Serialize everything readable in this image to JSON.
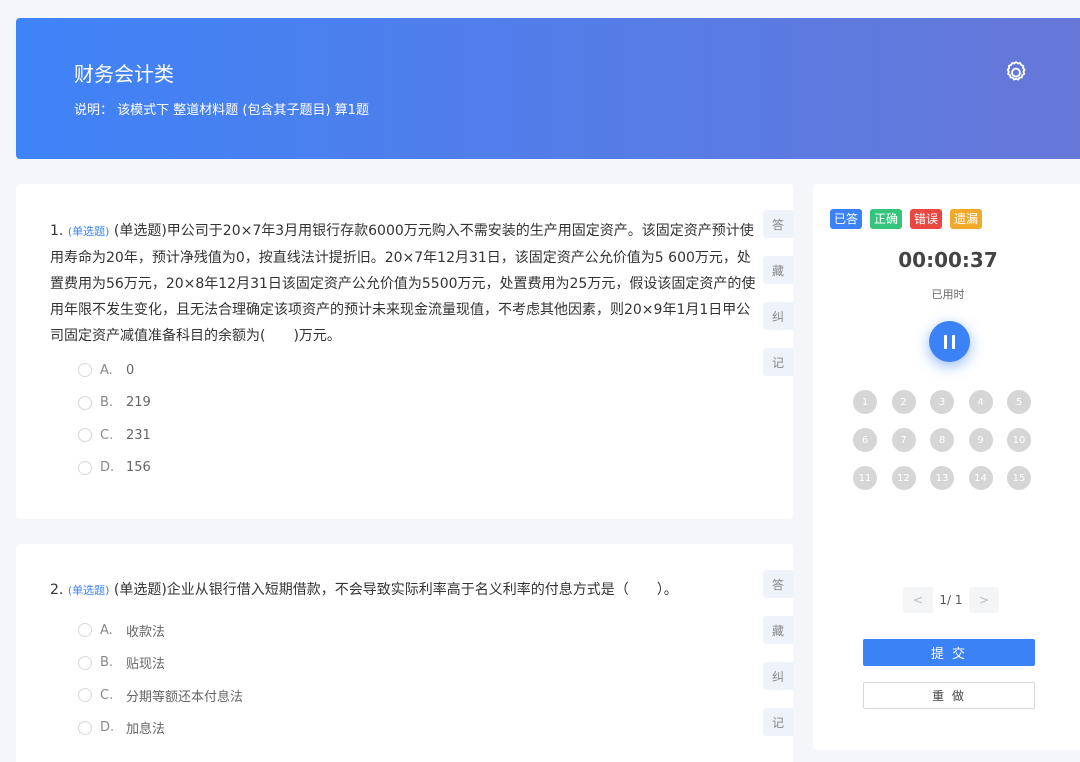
{
  "header": {
    "title": "财务会计类",
    "description": "说明： 该模式下 整道材料题 (包含其子题目) 算1题"
  },
  "questions": [
    {
      "number": "1.",
      "type_tag": "(单选题)",
      "text": "(单选题)甲公司于20×7年3月用银行存款6000万元购入不需安装的生产用固定资产。该固定资产预计使用寿命为20年，预计净残值为0，按直线法计提折旧。20×7年12月31日，该固定资产公允价值为5 600万元，处置费用为56万元，20×8年12月31日该固定资产公允价值为5500万元，处置费用为25万元，假设该固定资产的使用年限不发生变化，且无法合理确定该项资产的预计未来现金流量现值，不考虑其他因素，则20×9年1月1日甲公司固定资产减值准备科目的余额为(　　)万元。",
      "options": [
        {
          "letter": "A.",
          "text": "0"
        },
        {
          "letter": "B.",
          "text": "219"
        },
        {
          "letter": "C.",
          "text": "231"
        },
        {
          "letter": "D.",
          "text": "156"
        }
      ],
      "side_buttons": [
        "答",
        "藏",
        "纠",
        "记"
      ]
    },
    {
      "number": "2.",
      "type_tag": "(单选题)",
      "text": "(单选题)企业从银行借入短期借款，不会导致实际利率高于名义利率的付息方式是（　　）。",
      "options": [
        {
          "letter": "A.",
          "text": "收款法"
        },
        {
          "letter": "B.",
          "text": "贴现法"
        },
        {
          "letter": "C.",
          "text": "分期等额还本付息法"
        },
        {
          "letter": "D.",
          "text": "加息法"
        }
      ],
      "side_buttons": [
        "答",
        "藏",
        "纠",
        "记"
      ]
    }
  ],
  "panel": {
    "legend": [
      {
        "label": "已答",
        "color": "#3b82f6"
      },
      {
        "label": "正确",
        "color": "#34c47c"
      },
      {
        "label": "错误",
        "color": "#e9473f"
      },
      {
        "label": "遗漏",
        "color": "#f0a92a"
      }
    ],
    "timer": "00:00:37",
    "timer_label": "已用时",
    "numbers": [
      "1",
      "2",
      "3",
      "4",
      "5",
      "6",
      "7",
      "8",
      "9",
      "10",
      "11",
      "12",
      "13",
      "14",
      "15"
    ],
    "pager": {
      "prev": "<",
      "info": "1/ 1",
      "next": ">"
    },
    "submit_label": "提 交",
    "redo_label": "重 做"
  },
  "icons": {
    "settings": "gear-icon",
    "pause": "pause-icon"
  }
}
